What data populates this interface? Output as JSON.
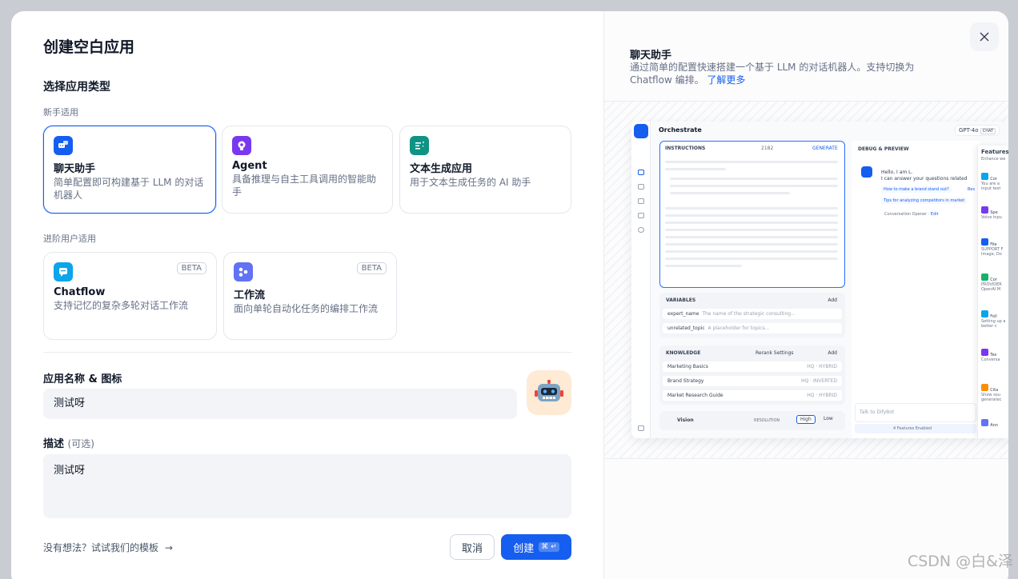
{
  "dialog": {
    "title": "创建空白应用",
    "type_section": "选择应用类型",
    "beginner_label": "新手适用",
    "advanced_label": "进阶用户适用",
    "beginner_cards": [
      {
        "name": "聊天助手",
        "desc": "简单配置即可构建基于 LLM 的对话机器人",
        "icon": "chat-bot-icon",
        "color": "#155eef"
      },
      {
        "name": "Agent",
        "desc": "具备推理与自主工具调用的智能助手",
        "icon": "agent-icon",
        "color": "#7839ee"
      },
      {
        "name": "文本生成应用",
        "desc": "用于文本生成任务的 AI 助手",
        "icon": "text-generation-icon",
        "color": "#0e9384"
      }
    ],
    "advanced_cards": [
      {
        "name": "Chatflow",
        "desc": "支持记忆的复杂多轮对话工作流",
        "badge": "BETA",
        "icon": "chatflow-icon",
        "color": "#0ba5ec"
      },
      {
        "name": "工作流",
        "desc": "面向单轮自动化任务的编排工作流",
        "badge": "BETA",
        "icon": "workflow-icon",
        "color": "#6172f3"
      }
    ],
    "name_label": "应用名称 & 图标",
    "name_value": "测试呀",
    "desc_label": "描述",
    "desc_optional": "(可选)",
    "desc_value": "测试呀",
    "template_link": "没有想法？试试我们的模板",
    "cancel": "取消",
    "create": "创建",
    "create_kbd": "⌘ ↵"
  },
  "preview": {
    "title": "聊天助手",
    "desc": "通过简单的配置快速搭建一个基于 LLM 的对话机器人。支持切换为 Chatflow 编排。",
    "learn_more": "了解更多",
    "orchestrate": "Orchestrate",
    "model": "GPT-4o",
    "model_mode": "CHAT",
    "instructions": "INSTRUCTIONS",
    "instructions_count": "2182",
    "generate": "GENERATE",
    "variables": "VARIABLES",
    "add": "Add",
    "var1_name": "expert_name",
    "var1_desc": "The name of the strategic consulting...",
    "var_type": "String",
    "var2_name": "unrelated_topic",
    "var2_desc": "A placeholder for topics...",
    "required": "REQUIRED",
    "knowledge": "KNOWLEDGE",
    "rerank": "Rerank Settings",
    "k1": "Marketing Basics",
    "k1_tag": "HQ · HYBRID",
    "k2": "Brand Strategy",
    "k2_tag": "HQ · INVERTED",
    "k3": "Market Research Guide",
    "k3_tag": "HQ · HYBRID",
    "vision": "Vision",
    "resolution": "RESOLUTION",
    "high": "High",
    "low": "Low",
    "debug": "DEBUG & PREVIEW",
    "hello1": "Hello, I am L.",
    "hello2": "I can answer your questions related",
    "q1": "How to make a brand stand out?",
    "q1b": "Bes",
    "q2": "Tips for analyzing competitors in market",
    "opener": "Conversation Opener",
    "edit": "Edit",
    "talk": "Talk to DifyBot",
    "features_enabled": "4 Features Enabled",
    "features": "Features",
    "enhance": "Enhance we",
    "f1": "Cor",
    "f1d": "You are a input text",
    "f2": "Spe",
    "f2d": "Voice inpu",
    "f3": "File",
    "f3d": "SUPPORT F Image, Do",
    "f4": "Cor",
    "f4d": "PROVIDER OpenAI M",
    "f5": "Foll",
    "f5d": "Setting up a better c",
    "f6": "Tex",
    "f6d": "Conversa",
    "f7": "Cita",
    "f7d": "Show sou generatec",
    "f8": "Ann"
  },
  "watermark": "CSDN @白&泽"
}
